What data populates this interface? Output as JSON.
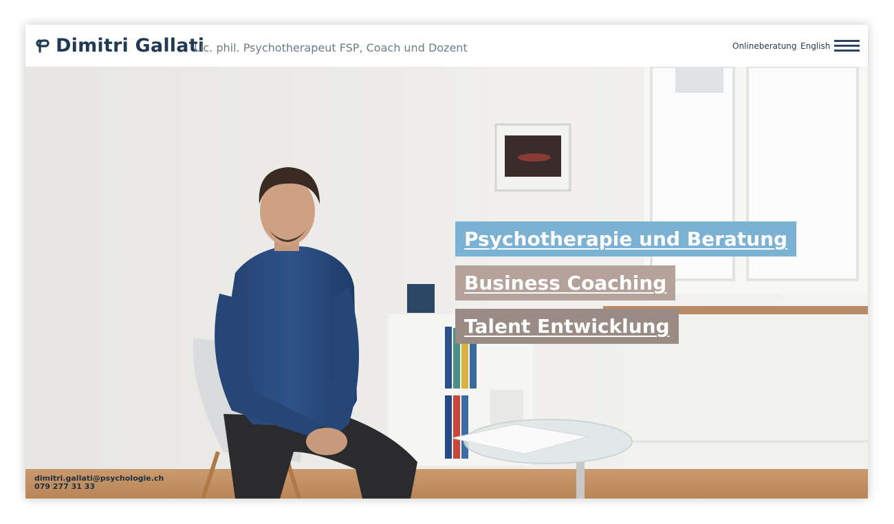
{
  "header": {
    "brand_name": "Dimitri Gallati",
    "tagline": "Lic. phil. Psychotherapeut FSP, Coach und Dozent",
    "nav": {
      "online_label": "Onlineberatung",
      "language_label": "English"
    },
    "icons": {
      "logo": "logo-mark-icon",
      "menu": "hamburger-menu-icon"
    }
  },
  "hero": {
    "services": [
      {
        "label": "Psychotherapie und Beratung",
        "color": "#7bb1d3"
      },
      {
        "label": "Business Coaching",
        "color": "#b5a29a"
      },
      {
        "label": "Talent Entwicklung",
        "color": "#9a8b84"
      }
    ]
  },
  "contact": {
    "email": "dimitri.gallati@psychologie.ch",
    "phone": "079 277 31 33"
  },
  "colors": {
    "brand": "#1f3a52",
    "accent_blue": "#7bb1d3",
    "accent_taupe": "#b5a29a",
    "accent_brown": "#9a8b84"
  }
}
